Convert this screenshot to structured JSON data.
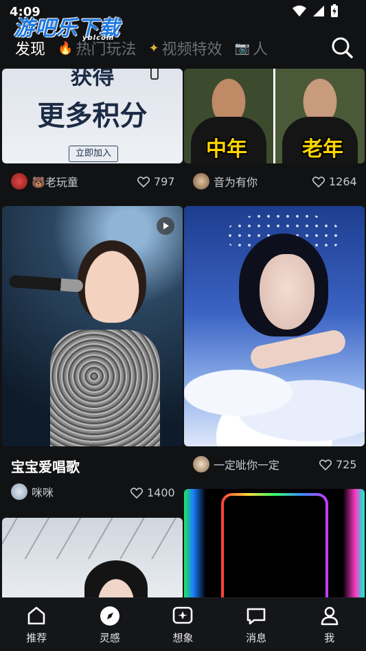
{
  "status": {
    "time": "4:09"
  },
  "watermark": {
    "text": "游吧乐下载",
    "sub": "yblcom"
  },
  "tabs": [
    {
      "label": "发现",
      "active": true,
      "icon": ""
    },
    {
      "label": "热门玩法",
      "active": false,
      "icon": "fire-icon"
    },
    {
      "label": "视频特效",
      "active": false,
      "icon": "sparkle-icon"
    },
    {
      "label": "人",
      "active": false,
      "icon": "camera-icon"
    }
  ],
  "feed": {
    "card1": {
      "promo_line1": "获得",
      "promo_line2": "更多积分",
      "promo_button": "立即加入",
      "author": "🐻老玩童",
      "likes": "797"
    },
    "card2": {
      "label_left": "中年",
      "label_right": "老年",
      "author": "音为有你",
      "likes": "1264"
    },
    "card3": {
      "title": "宝宝爱唱歌",
      "author": "咪咪",
      "likes": "1400"
    },
    "card4": {
      "author": "一定呲你一定",
      "likes": "725"
    }
  },
  "nav": [
    {
      "label": "推荐",
      "icon": "home-icon"
    },
    {
      "label": "灵感",
      "icon": "compass-icon"
    },
    {
      "label": "想象",
      "icon": "sparkle-box-icon"
    },
    {
      "label": "消息",
      "icon": "message-icon"
    },
    {
      "label": "我",
      "icon": "person-icon"
    }
  ]
}
